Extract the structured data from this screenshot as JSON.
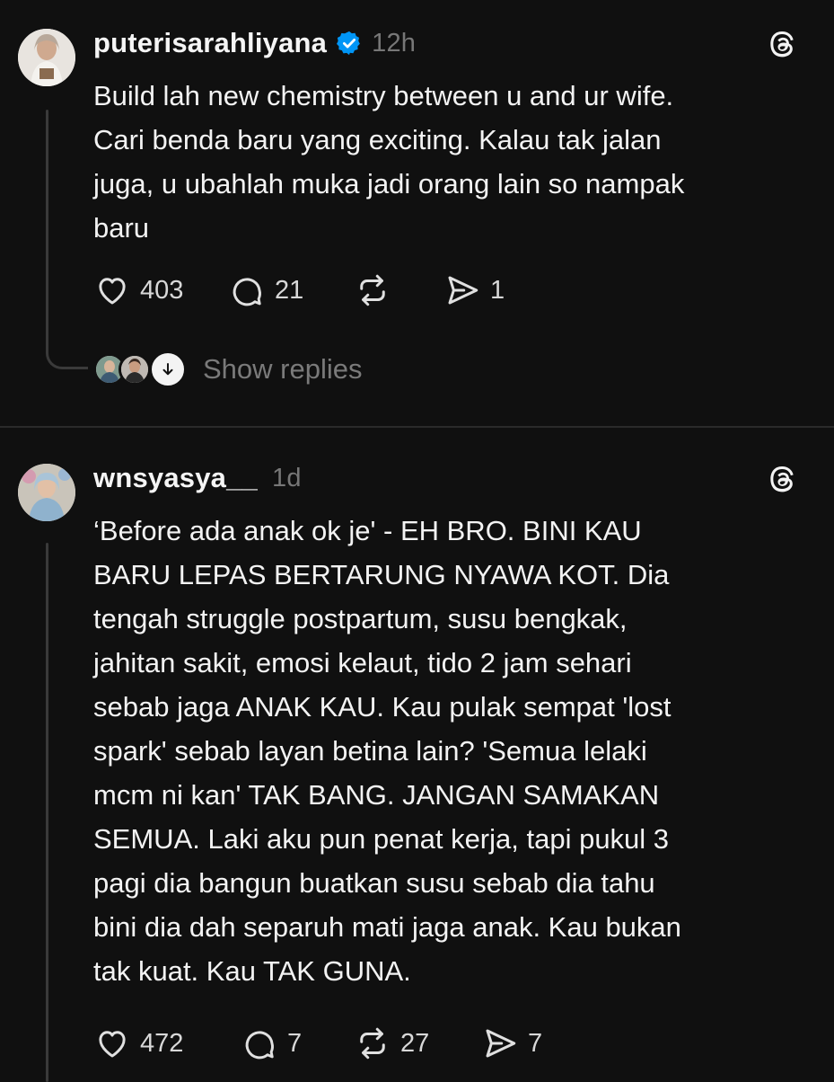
{
  "posts": [
    {
      "username": "puterisarahliyana",
      "verified": true,
      "time": "12h",
      "text": "Build lah new chemistry between u and ur wife.\nCari benda baru yang exciting. Kalau tak jalan\njuga, u ubahlah muka jadi orang lain so nampak\nbaru",
      "likes": "403",
      "comments": "21",
      "reposts": "",
      "shares": "1",
      "show_replies": "Show replies"
    },
    {
      "username": "wnsyasya__",
      "verified": false,
      "time": "1d",
      "text": "‘Before ada anak ok je' - EH BRO. BINI KAU\nBARU LEPAS BERTARUNG NYAWA KOT.  Dia\ntengah struggle postpartum, susu bengkak,\njahitan sakit, emosi kelaut, tido 2 jam sehari\nsebab jaga ANAK KAU. Kau pulak sempat 'lost\nspark' sebab layan betina lain? 'Semua lelaki\nmcm ni kan' TAK BANG. JANGAN SAMAKAN\nSEMUA. Laki aku pun penat kerja, tapi pukul 3\npagi dia bangun buatkan susu sebab dia tahu\nbini dia dah separuh mati jaga anak. Kau bukan\ntak kuat. Kau TAK GUNA.",
      "likes": "472",
      "comments": "7",
      "reposts": "27",
      "shares": "7"
    }
  ],
  "colors": {
    "background": "#101010",
    "text": "#f3f3f3",
    "muted": "#777777",
    "verified": "#0095f6"
  },
  "icons": [
    "heart-icon",
    "comment-icon",
    "repost-icon",
    "share-icon",
    "threads-logo-icon",
    "verified-badge-icon",
    "chevron-down-icon"
  ]
}
